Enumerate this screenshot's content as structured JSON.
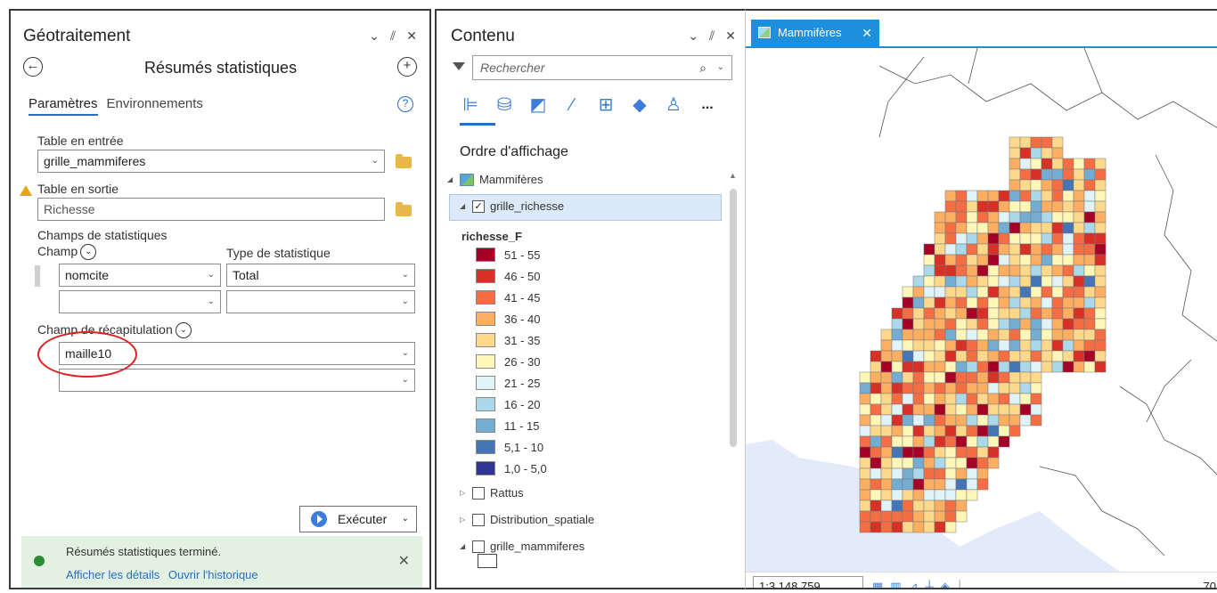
{
  "geo": {
    "title": "Géotraitement",
    "win_ctrl_dd": "⌄",
    "win_ctrl_pin": "⫽",
    "win_ctrl_close": "✕",
    "back_glyph": "←",
    "add_glyph": "+",
    "tool_title": "Résumés statistiques",
    "tab_params": "Paramètres",
    "tab_env": "Environnements",
    "help_glyph": "?",
    "input_table_label": "Table en entrée",
    "input_table_value": "grille_mammiferes",
    "output_table_label": "Table en sortie",
    "output_table_value": "Richesse",
    "stats_fields_label": "Champs de statistiques",
    "field_label": "Champ",
    "stat_type_label": "Type de statistique",
    "stat_field_1": "nomcite",
    "stat_type_1": "Total",
    "stat_field_2": "",
    "stat_type_2": "",
    "case_field_label": "Champ de récapitulation",
    "case_field_1": "maille10",
    "case_field_2": "",
    "run_label": "Exécuter",
    "status_message": "Résumés statistiques terminé.",
    "link_details": "Afficher les détails",
    "link_history": "Ouvrir l'historique",
    "dd_glyph": "⌄"
  },
  "contenu": {
    "title": "Contenu",
    "search_placeholder": "Rechercher",
    "search_glyph": "⌕",
    "toolbar_glyphs": [
      "⊫",
      "⛁",
      "◩",
      "⁄",
      "⊞",
      "◆",
      "♙",
      "..."
    ],
    "section_title": "Ordre d'affichage",
    "layers": {
      "map": "Mammifères",
      "selected": "grille_richesse",
      "rattus": "Rattus",
      "distribution": "Distribution_spatiale",
      "grille": "grille_mammiferes"
    },
    "legend_field": "richesse_F",
    "legend": [
      {
        "label": "51 - 55",
        "color": "#a50026"
      },
      {
        "label": "46 - 50",
        "color": "#d73027"
      },
      {
        "label": "41 - 45",
        "color": "#f46d43"
      },
      {
        "label": "36 - 40",
        "color": "#fdae61"
      },
      {
        "label": "31 - 35",
        "color": "#fed88b"
      },
      {
        "label": "26 - 30",
        "color": "#fff7b8"
      },
      {
        "label": "21 - 25",
        "color": "#e0f3f8"
      },
      {
        "label": "16 - 20",
        "color": "#abd9e9"
      },
      {
        "label": "11 - 15",
        "color": "#74add1"
      },
      {
        "label": "5,1 - 10",
        "color": "#4575b4"
      },
      {
        "label": "1,0 - 5,0",
        "color": "#313695"
      }
    ]
  },
  "map": {
    "tab_label": "Mammifères",
    "tab_close": "✕",
    "scale": "1:3 148 759",
    "right_readout": "70",
    "icons": [
      "▦",
      "▥",
      "⊿",
      "┼",
      "◈",
      "│"
    ],
    "sea_color": "#e3ebfa",
    "land_color": "#ffffff"
  }
}
